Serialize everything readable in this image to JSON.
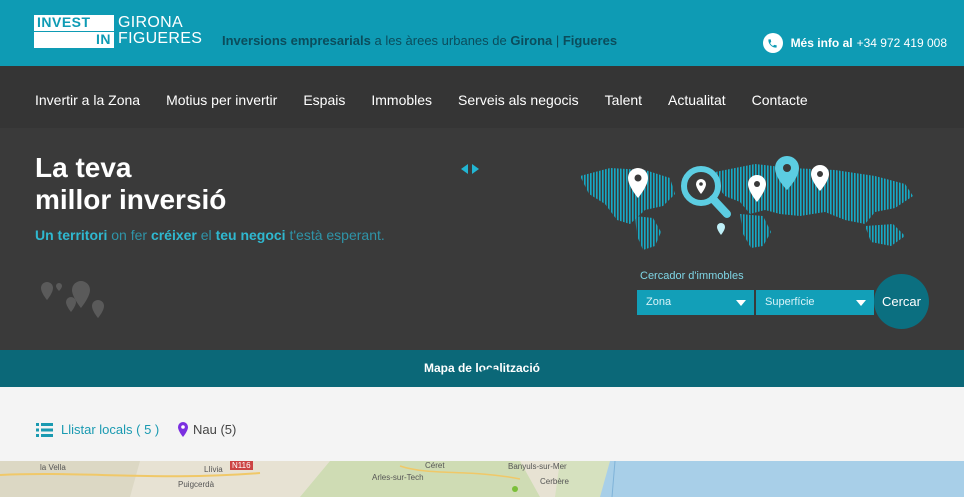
{
  "header": {
    "logo": {
      "invest": "INVEST",
      "in": "IN",
      "girona": "GIRONA",
      "figueres": "FIGUERES"
    },
    "tagline": {
      "bold1": "Inversions empresarials",
      "normal": " a les àrees urbanes de ",
      "bold2": "Girona",
      "sep": " | ",
      "bold3": "Figueres"
    },
    "info_label": "Més info al",
    "phone": "+34 972 419 008"
  },
  "nav": {
    "items": [
      {
        "label": "Invertir a la Zona"
      },
      {
        "label": "Motius per invertir"
      },
      {
        "label": "Espais"
      },
      {
        "label": "Immobles"
      },
      {
        "label": "Serveis als negocis"
      },
      {
        "label": "Talent"
      },
      {
        "label": "Actualitat"
      },
      {
        "label": "Contacte"
      }
    ]
  },
  "hero": {
    "title_line1": "La teva",
    "title_line2": "millor inversió",
    "sub": {
      "p1": "Un territori",
      "p2": " on fer ",
      "p3": "créixer",
      "p4": " el ",
      "p5": "teu negoci",
      "p6": " t'està esperant."
    }
  },
  "search": {
    "label": "Cercador d'immobles",
    "zona": "Zona",
    "superficie": "Superfície",
    "button": "Cercar"
  },
  "map_section": {
    "title": "Mapa de localització",
    "list_label": "Llistar locals ( 5 )",
    "nau_label": "Nau (5)"
  },
  "map_places": [
    "la Vella",
    "Llívia",
    "N116",
    "Puigcerdà",
    "Céret",
    "Arles-sur-Tech",
    "Banyuls-sur-Mer",
    "Cerbère"
  ],
  "colors": {
    "primary": "#0e9bb4",
    "dark": "#353535",
    "mapbar": "#0b6878",
    "accent": "#2fb8d0"
  }
}
